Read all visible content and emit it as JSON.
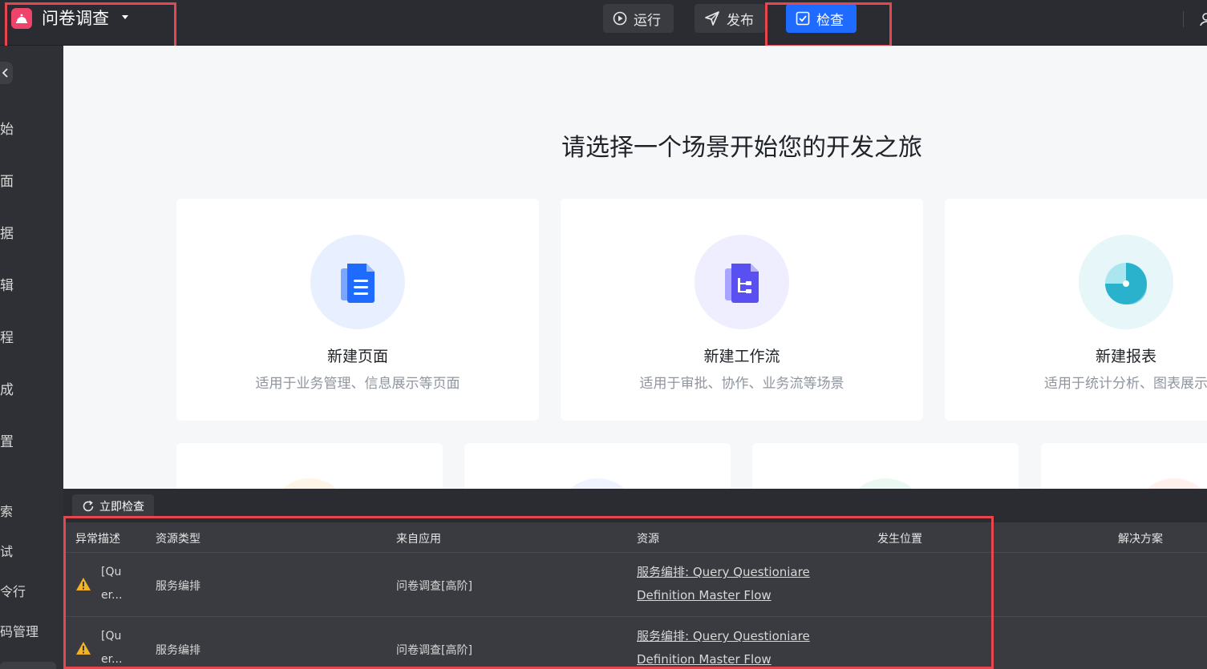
{
  "topbar": {
    "app_title": "问卷调查",
    "run_label": "运行",
    "publish_label": "发布",
    "check_label": "检查",
    "check_color": "#1f6bff",
    "logo_color": "#f0436c"
  },
  "sidebar": {
    "items": [
      {
        "label": "始"
      },
      {
        "label": "面"
      },
      {
        "label": "据"
      },
      {
        "label": "辑"
      },
      {
        "label": "程"
      },
      {
        "label": "成"
      },
      {
        "label": "置"
      },
      {
        "label": "索"
      },
      {
        "label": "试"
      },
      {
        "label": "令行"
      },
      {
        "label": "码管理"
      }
    ]
  },
  "main": {
    "heading": "请选择一个场景开始您的开发之旅",
    "cards": [
      {
        "title": "新建页面",
        "desc": "适用于业务管理、信息展示等页面",
        "icon": "document-icon"
      },
      {
        "title": "新建工作流",
        "desc": "适用于审批、协作、业务流等场景",
        "icon": "workflow-icon"
      },
      {
        "title": "新建报表",
        "desc": "适用于统计分析、图表展示",
        "icon": "chart-icon"
      }
    ]
  },
  "panel": {
    "check_now_label": "立即检查",
    "columns": [
      "异常描述",
      "资源类型",
      "来自应用",
      "资源",
      "发生位置",
      "解决方案"
    ],
    "rows": [
      {
        "desc_line1": "[Qu",
        "desc_line2": "er...",
        "type": "服务编排",
        "app": "问卷调查[高阶]",
        "resource_line1": "服务编排: Query Questioniare",
        "resource_line2": "Definition Master Flow"
      },
      {
        "desc_line1": "[Qu",
        "desc_line2": "er...",
        "type": "服务编排",
        "app": "问卷调查[高阶]",
        "resource_line1": "服务编排: Query Questioniare",
        "resource_line2": "Definition Master Flow"
      }
    ]
  }
}
